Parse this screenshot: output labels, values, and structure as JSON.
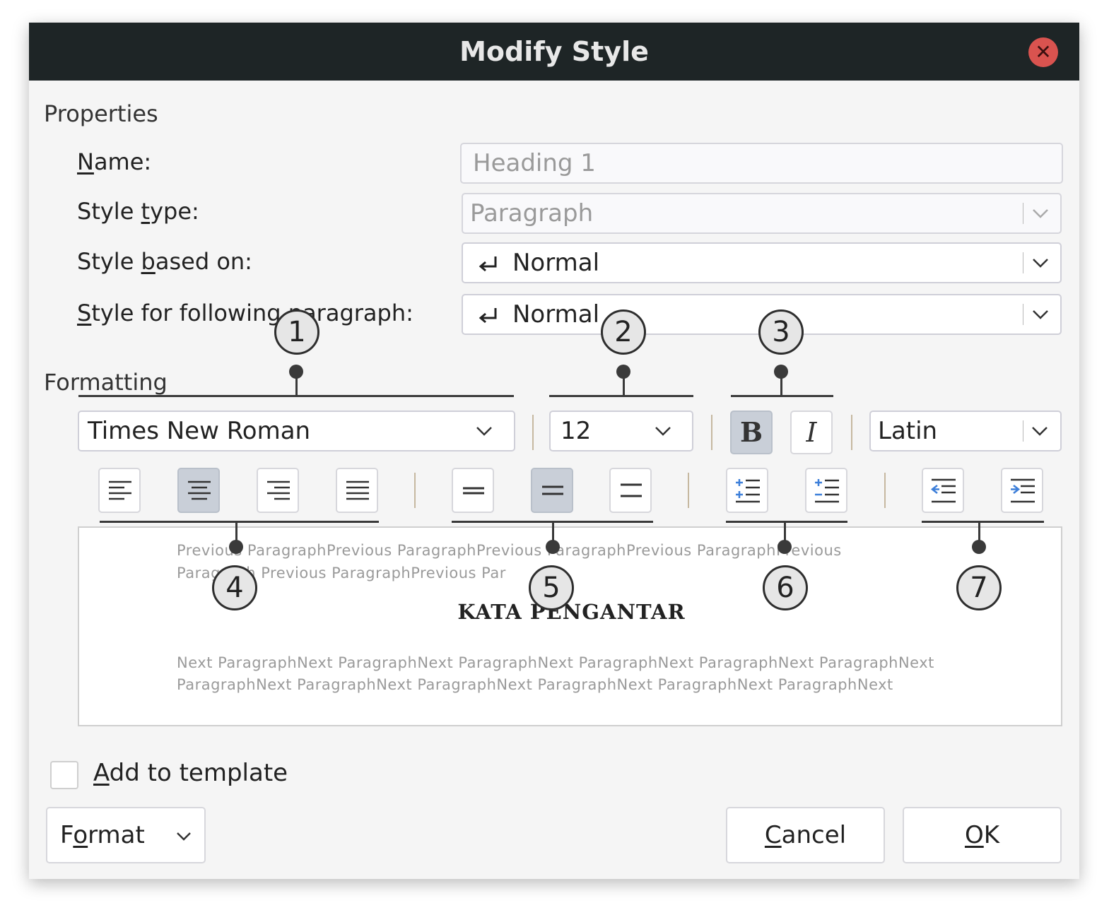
{
  "window": {
    "title": "Modify Style"
  },
  "properties": {
    "section_label": "Properties",
    "name": {
      "label_pre": "",
      "label_ul": "N",
      "label_post": "ame:",
      "value": "Heading 1"
    },
    "style_type": {
      "label_pre": "Style ",
      "label_ul": "t",
      "label_post": "ype:",
      "value": "Paragraph"
    },
    "based_on": {
      "label_pre": "Style ",
      "label_ul": "b",
      "label_post": "ased on:",
      "value": "Normal"
    },
    "following": {
      "label_pre": "",
      "label_ul": "S",
      "label_post": "tyle for following paragraph:",
      "value": "Normal"
    }
  },
  "formatting": {
    "section_label": "Formatting",
    "font": "Times New Roman",
    "size": "12",
    "bold_label": "B",
    "italic_label": "I",
    "script": "Latin",
    "alignment_selected": "center",
    "spacing_selected": "1.5",
    "icons": [
      "align-left-icon",
      "align-center-icon",
      "align-right-icon",
      "align-justify-icon",
      "line-spacing-single-icon",
      "line-spacing-1-5-icon",
      "line-spacing-double-icon",
      "paragraph-spacing-increase-icon",
      "paragraph-spacing-decrease-icon",
      "indent-decrease-icon",
      "indent-increase-icon"
    ]
  },
  "callouts": [
    "1",
    "2",
    "3",
    "4",
    "5",
    "6",
    "7"
  ],
  "preview": {
    "previous_line1": "Previous ParagraphPrevious ParagraphPrevious ParagraphPrevious ParagraphPrevious",
    "previous_line2": "Paragraph Previous ParagraphPrevious Par",
    "heading": "KATA PENGANTAR",
    "next_line1": "Next ParagraphNext ParagraphNext ParagraphNext ParagraphNext ParagraphNext ParagraphNext",
    "next_line2": "ParagraphNext ParagraphNext ParagraphNext ParagraphNext ParagraphNext ParagraphNext"
  },
  "add_to_template": {
    "label_ul": "A",
    "label_post": "dd to template",
    "checked": false
  },
  "footer": {
    "format": {
      "pre": "F",
      "ul": "o",
      "post": "rmat"
    },
    "cancel": {
      "ul": "C",
      "post": "ancel"
    },
    "ok": {
      "ul": "O",
      "post": "K"
    }
  },
  "colors": {
    "titlebar": "#1e2526",
    "close": "#d9534f",
    "selected_button": "#c9cfd8",
    "accent_icon": "#3d7fd9"
  }
}
